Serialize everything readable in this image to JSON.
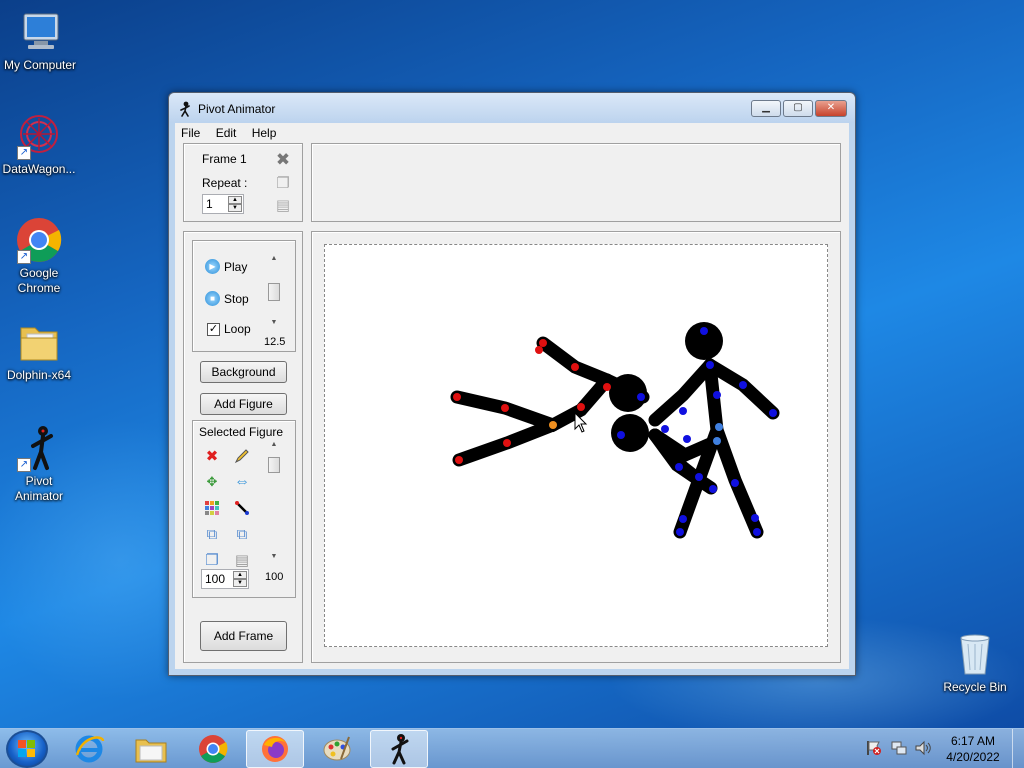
{
  "desktop": {
    "icons": [
      {
        "label": "My Computer"
      },
      {
        "label": "DataWagon..."
      },
      {
        "label": "Google Chrome"
      },
      {
        "label": "Dolphin-x64"
      },
      {
        "label": "Pivot Animator"
      },
      {
        "label": "Recycle Bin"
      }
    ]
  },
  "window": {
    "title": "Pivot Animator",
    "menu": [
      "File",
      "Edit",
      "Help"
    ],
    "frame_panel": {
      "frame_label": "Frame 1",
      "repeat_label": "Repeat :",
      "repeat_value": "1"
    },
    "playback": {
      "play_label": "Play",
      "stop_label": "Stop",
      "loop_label": "Loop",
      "loop_checked": true,
      "speed_value": "12.5"
    },
    "buttons": {
      "background": "Background",
      "add_figure": "Add Figure",
      "add_frame": "Add Frame"
    },
    "selected_figure": {
      "heading": "Selected Figure",
      "size_value": "100",
      "scale_value": "100"
    }
  },
  "taskbar": {
    "time": "6:17 AM",
    "date": "4/20/2022",
    "active_app": "Pivot Animator"
  },
  "colors": {
    "figure_red_joint": "#e01010",
    "figure_blue_joint": "#1010e0",
    "figure_orange_joint": "#f09020",
    "stick": "#000000"
  }
}
